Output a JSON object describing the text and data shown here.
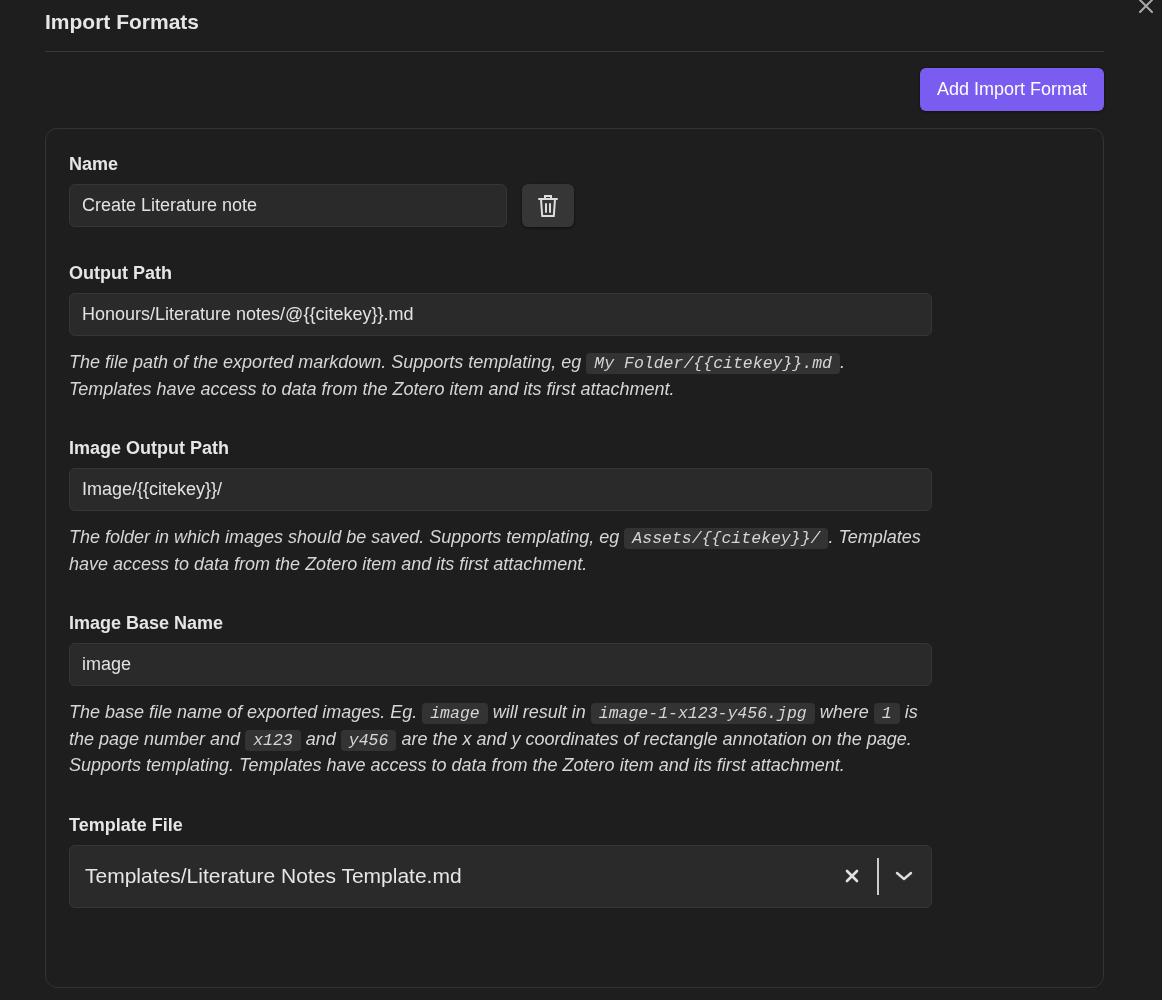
{
  "title": "Import Formats",
  "add_button": "Add Import Format",
  "fields": [
    {
      "kind": "text-with-delete",
      "label": "Name",
      "value": "Create Literature note"
    },
    {
      "kind": "text",
      "label": "Output Path",
      "value": "Honours/Literature notes/@{{citekey}}.md",
      "description": [
        {
          "kind": "text",
          "text": "The file path of the exported markdown. Supports templating, eg "
        },
        {
          "kind": "code",
          "text": "My Folder/{{citekey}}.md"
        },
        {
          "kind": "text",
          "text": ". Templates have access to data from the Zotero item and its first attachment."
        }
      ]
    },
    {
      "kind": "text",
      "label": "Image Output Path",
      "value": "Image/{{citekey}}/",
      "description": [
        {
          "kind": "text",
          "text": "The folder in which images should be saved. Supports templating, eg "
        },
        {
          "kind": "code",
          "text": "Assets/{{citekey}}/"
        },
        {
          "kind": "text",
          "text": ". Templates have access to data from the Zotero item and its first attachment."
        }
      ]
    },
    {
      "kind": "text",
      "label": "Image Base Name",
      "value": "image",
      "description": [
        {
          "kind": "text",
          "text": "The base file name of exported images. Eg. "
        },
        {
          "kind": "code",
          "text": "image"
        },
        {
          "kind": "text",
          "text": " will result in "
        },
        {
          "kind": "code",
          "text": "image-1-x123-y456.jpg"
        },
        {
          "kind": "text",
          "text": " where "
        },
        {
          "kind": "code",
          "text": "1"
        },
        {
          "kind": "text",
          "text": " is the page number and "
        },
        {
          "kind": "code",
          "text": "x123"
        },
        {
          "kind": "text",
          "text": " and "
        },
        {
          "kind": "code",
          "text": "y456"
        },
        {
          "kind": "text",
          "text": " are the x and y coordinates of rectangle annotation on the page. Supports templating. Templates have access to data from the Zotero item and its first attachment."
        }
      ]
    },
    {
      "kind": "select",
      "label": "Template File",
      "value": "Templates/Literature Notes Template.md"
    }
  ]
}
